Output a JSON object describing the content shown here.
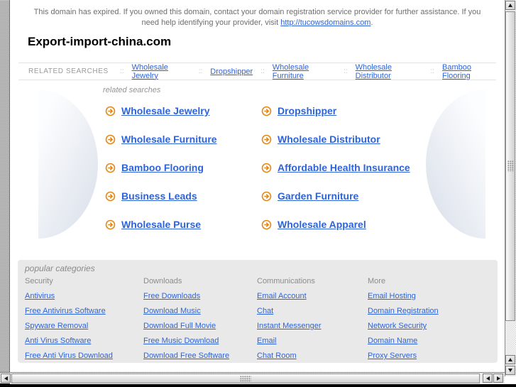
{
  "notice": {
    "text": "This domain has expired. If you owned this domain, contact your domain registration service provider for further assistance. If you need help identifying your provider, visit ",
    "link_text": "http://tucowsdomains.com",
    "suffix": "."
  },
  "header": {
    "domain_title": "Export-import-china.com"
  },
  "related_bar": {
    "label": "RELATED SEARCHES",
    "separator": "::",
    "links": [
      "Wholesale Jewelry",
      "Dropshipper",
      "Wholesale Furniture",
      "Wholesale Distributor",
      "Bamboo Flooring"
    ]
  },
  "related_searches": {
    "heading": "related searches",
    "left_column": [
      "Wholesale Jewelry",
      "Wholesale Furniture",
      "Bamboo Flooring",
      "Business Leads",
      "Wholesale Purse"
    ],
    "right_column": [
      "Dropshipper",
      "Wholesale Distributor",
      "Affordable Health Insurance",
      "Garden Furniture",
      "Wholesale Apparel"
    ]
  },
  "popular_categories": {
    "heading": "popular categories",
    "columns": [
      {
        "header": "Security",
        "links": [
          "Antivirus",
          "Free Antivirus Software",
          "Spyware Removal",
          "Anti Virus Software",
          "Free Anti Virus Download"
        ]
      },
      {
        "header": "Downloads",
        "links": [
          "Free Downloads",
          "Download Music",
          "Download Full Movie",
          "Free Music Download",
          "Download Free Software"
        ]
      },
      {
        "header": "Communications",
        "links": [
          "Email Account",
          "Chat",
          "Instant Messenger",
          "Email",
          "Chat Room"
        ]
      },
      {
        "header": "More",
        "links": [
          "Email Hosting",
          "Domain Registration",
          "Network Security",
          "Domain Name",
          "Proxy Servers"
        ]
      }
    ]
  },
  "colors": {
    "link_blue": "#2e64d8",
    "icon_orange": "#e2881c",
    "text_gray": "#6e6e6e",
    "heading_gray": "#949494",
    "box_bg": "#e9e9e9"
  }
}
